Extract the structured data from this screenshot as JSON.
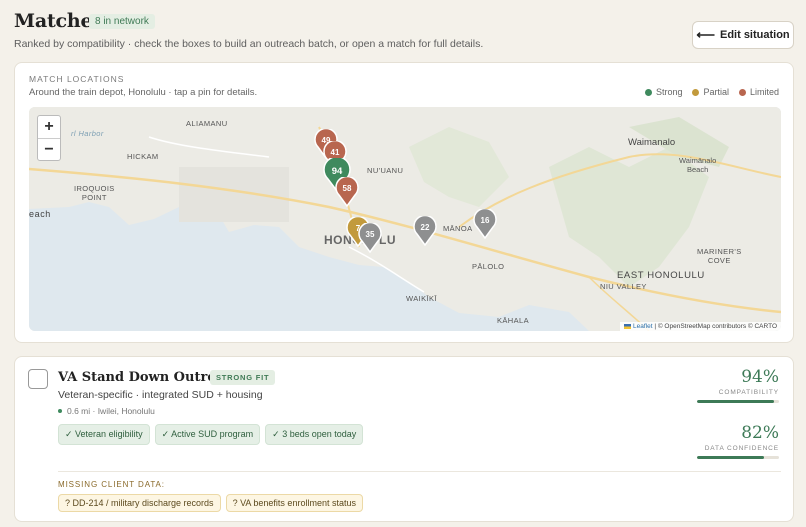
{
  "header": {
    "title": "Matches",
    "network_badge": "8 in network",
    "subtitle": "Ranked by compatibility · check the boxes to build an outreach batch, or open a match for full details.",
    "edit_button": "Edit situation"
  },
  "map_panel": {
    "label": "MATCH LOCATIONS",
    "subtitle": "Around the train depot, Honolulu · tap a pin for details.",
    "legend": [
      {
        "label": "Strong",
        "color": "#3f8a5e"
      },
      {
        "label": "Partial",
        "color": "#c29a3c"
      },
      {
        "label": "Limited",
        "color": "#b8664f"
      }
    ],
    "zoom_in": "+",
    "zoom_out": "−",
    "attribution": {
      "leaflet": "Leaflet",
      "rest": " | © OpenStreetMap contributors © CARTO"
    },
    "places": {
      "pearl_harbor": "rl Harbor",
      "aliamanu": "ALIAMANU",
      "hickam": "HICKAM",
      "iroquois": "IROQUOIS\nPOINT",
      "beach": "each",
      "nuuanu": "NU'UANU",
      "honolulu": "HONOLULU",
      "manoa": "MĀNOA",
      "palolo": "PĀLOLO",
      "waikiki": "WAIKĪKĪ",
      "kahala": "KĀHALA",
      "niu_valley": "NIU VALLEY",
      "east_honolulu": "EAST HONOLULU",
      "mariners_cove": "MARINER'S\nCOVE",
      "waimanalo": "Waimanalo",
      "waimanalo_beach": "Waimānalo\nBeach"
    },
    "pins": [
      {
        "score": "49",
        "tier": "limited"
      },
      {
        "score": "41",
        "tier": "limited"
      },
      {
        "score": "94",
        "tier": "strong"
      },
      {
        "score": "58",
        "tier": "limited"
      },
      {
        "score": "7",
        "tier": "partial"
      },
      {
        "score": "35",
        "tier": "none"
      },
      {
        "score": "22",
        "tier": "none"
      },
      {
        "score": "16",
        "tier": "none"
      }
    ]
  },
  "result": {
    "name": "VA Stand Down Outreach",
    "fit_badge": "STRONG FIT",
    "description": "Veteran-specific · integrated SUD + housing",
    "location": "0.6 mi · Iwilei, Honolulu",
    "tags": [
      "✓ Veteran eligibility",
      "✓ Active SUD program",
      "✓ 3 beds open today"
    ],
    "missing_label": "MISSING CLIENT DATA:",
    "missing": [
      "? DD-214 / military discharge records",
      "? VA benefits enrollment status"
    ],
    "compatibility": {
      "value_text": "94%",
      "value": 94,
      "label": "COMPATIBILITY"
    },
    "confidence": {
      "value_text": "82%",
      "value": 82,
      "label": "DATA CONFIDENCE"
    }
  }
}
